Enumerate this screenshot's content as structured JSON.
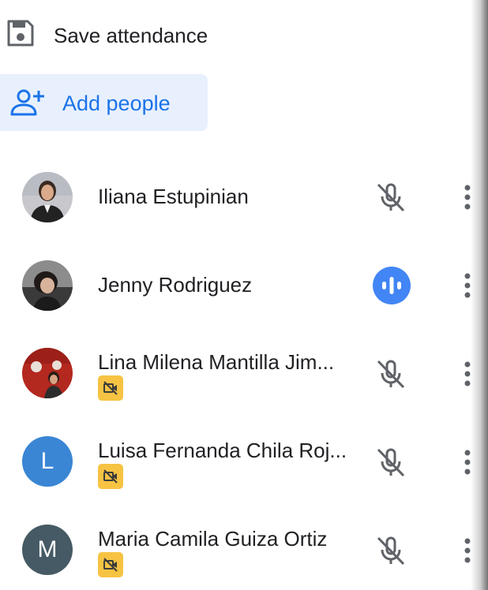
{
  "save_attendance": {
    "label": "Save attendance",
    "icon": "save-icon"
  },
  "add_people": {
    "label": "Add people",
    "icon": "person-add-icon",
    "color": "#1a73e8",
    "background": "#e8f0fe"
  },
  "participants": [
    {
      "name": "Iliana Estupinian",
      "avatar": "photo",
      "mic": "muted"
    },
    {
      "name": "Jenny Rodriguez",
      "avatar": "photo",
      "mic": "speaking"
    },
    {
      "name": "Lina Milena Mantilla Jim...",
      "avatar": "photo",
      "mic": "muted",
      "camera_off_badge": true
    },
    {
      "name": "Luisa Fernanda Chila Roj...",
      "avatar_initial": "L",
      "avatar_color": "#3a86d4",
      "mic": "muted",
      "camera_off_badge": true
    },
    {
      "name": "Maria Camila Guiza Ortiz",
      "avatar_initial": "M",
      "avatar_color": "#455a64",
      "mic": "muted",
      "camera_off_badge": true
    }
  ],
  "colors": {
    "accent": "#1a73e8",
    "speaking": "#4285f4",
    "badge": "#f6c343",
    "icon_gray": "#5f6368"
  }
}
